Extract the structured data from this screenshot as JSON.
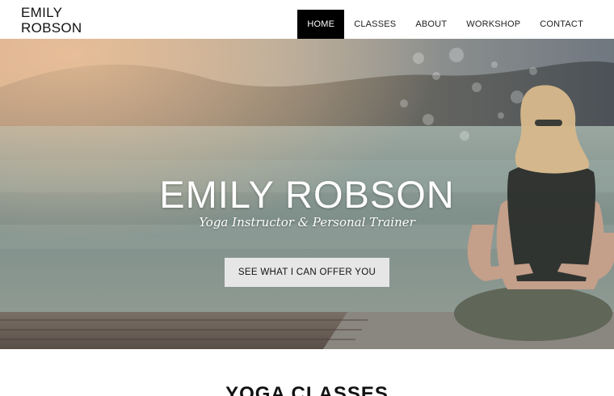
{
  "header": {
    "logo_line1": "EMILY",
    "logo_line2": "ROBSON",
    "nav": [
      {
        "label": "HOME",
        "active": true
      },
      {
        "label": "CLASSES",
        "active": false
      },
      {
        "label": "ABOUT",
        "active": false
      },
      {
        "label": "WORKSHOP",
        "active": false
      },
      {
        "label": "CONTACT",
        "active": false
      }
    ]
  },
  "hero": {
    "title": "EMILY ROBSON",
    "subtitle": "Yoga Instructor & Personal Trainer",
    "cta_label": "SEE WHAT I CAN OFFER YOU"
  },
  "section": {
    "title_bold": "YOGA",
    "title_rest": " CLASSES"
  },
  "colors": {
    "nav_active_bg": "#000000",
    "cta_bg": "#e6e6e6",
    "lake": "#7f8f8a"
  }
}
